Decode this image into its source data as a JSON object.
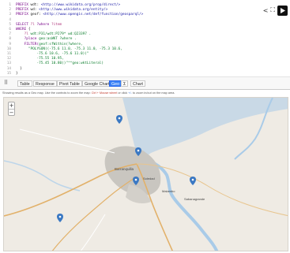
{
  "editor": {
    "lines": [
      {
        "n": "1",
        "parts": [
          [
            "kw",
            "PREFIX "
          ],
          [
            "pn",
            "wdt: "
          ],
          [
            "url",
            "<http://www.wikidata.org/prop/direct/>"
          ]
        ]
      },
      {
        "n": "2",
        "parts": [
          [
            "kw",
            "PREFIX "
          ],
          [
            "pn",
            "wd: "
          ],
          [
            "url",
            "<http://www.wikidata.org/entity/>"
          ]
        ]
      },
      {
        "n": "3",
        "parts": [
          [
            "kw",
            "PREFIX "
          ],
          [
            "pn",
            "geof: "
          ],
          [
            "url",
            "<http://www.opengis.net/def/function/geosparql/>"
          ]
        ]
      },
      {
        "n": "4",
        "parts": [
          [
            "pn",
            ""
          ]
        ]
      },
      {
        "n": "5",
        "parts": [
          [
            "kw",
            "SELECT "
          ],
          [
            "var",
            "?l "
          ],
          [
            "kw",
            "?where "
          ],
          [
            "var",
            "?item"
          ]
        ]
      },
      {
        "n": "6",
        "parts": [
          [
            "kw",
            "WHERE "
          ],
          [
            "pn",
            "{"
          ]
        ]
      },
      {
        "n": "7",
        "parts": [
          [
            "pn",
            "    "
          ],
          [
            "var",
            "?l "
          ],
          [
            "str",
            "wdt:P31/wdt:P279* wd:Q23397 ."
          ]
        ]
      },
      {
        "n": "8",
        "parts": [
          [
            "pn",
            "    "
          ],
          [
            "kw",
            "?place "
          ],
          [
            "str",
            "geo:asWKT ?where ."
          ]
        ]
      },
      {
        "n": "9",
        "parts": [
          [
            "pn",
            "    "
          ],
          [
            "kw",
            "FILTER("
          ],
          [
            "str",
            "geof:sfWithin(?where,"
          ]
        ]
      },
      {
        "n": "10",
        "parts": [
          [
            "pn",
            "      "
          ],
          [
            "str",
            "\"POLYGON((-75.6 11.0, -75.3 11.0, -75.3 10.6,"
          ]
        ]
      },
      {
        "n": "11",
        "parts": [
          [
            "pn",
            "          "
          ],
          [
            "str",
            "-75.6 10.6, -75.6 11.0))\""
          ]
        ]
      },
      {
        "n": "12",
        "parts": [
          [
            "pn",
            "          "
          ],
          [
            "str",
            "-75.55 10.95,"
          ]
        ]
      },
      {
        "n": "13",
        "parts": [
          [
            "pn",
            "          "
          ],
          [
            "str",
            "-75.45 10.80))\"^^geo:wktLiteral)"
          ]
        ]
      },
      {
        "n": "14",
        "parts": [
          [
            "pn",
            "  }"
          ]
        ]
      },
      {
        "n": "15",
        "parts": [
          [
            "pn",
            "}"
          ]
        ]
      }
    ]
  },
  "controls": {
    "share_icon": "share-icon",
    "expand_icon": "expand-icon",
    "run_icon": "play-icon"
  },
  "tabs": {
    "items": [
      {
        "label": "Table",
        "active": false
      },
      {
        "label": "Response",
        "active": false
      },
      {
        "label": "Pivot Table",
        "active": false
      },
      {
        "label": "Google Chart",
        "active": false
      },
      {
        "label": "Geo",
        "active": true
      },
      {
        "label": "Σ",
        "active": false
      },
      {
        "label": "Chart",
        "active": false
      }
    ],
    "icon": "drag-handle-icon"
  },
  "note": {
    "prefix": "Showing results as a Geo map. Use the controls to zoom the map: ",
    "part1": "Ctrl + Mouse wheel",
    "mid": " or click ",
    "part2": "+/-",
    "suffix": " to zoom in/out on the map area."
  },
  "map": {
    "zoom_in": "+",
    "zoom_out": "−",
    "colors": {
      "land": "#efebe4",
      "water": "#a9cbe8",
      "urban": "#c9c6c0",
      "road_major": "#e2b16a",
      "road_minor": "#ffffff",
      "marker": "#3a78c3"
    },
    "places": [
      "Barranquilla",
      "Soledad",
      "Malambo",
      "Sabanagrande"
    ]
  }
}
